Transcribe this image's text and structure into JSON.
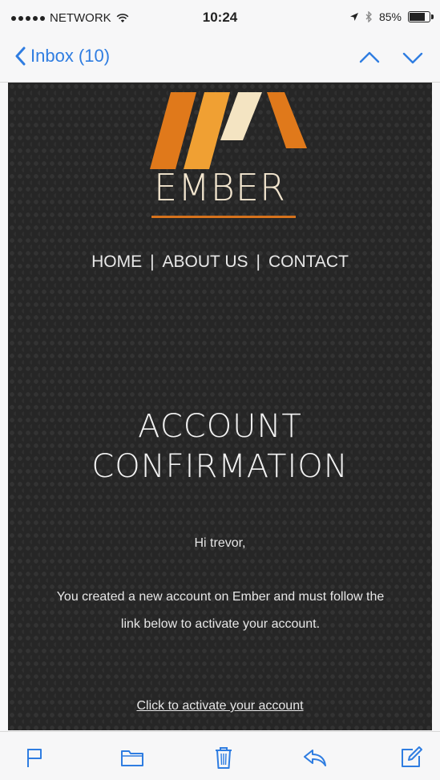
{
  "status_bar": {
    "carrier": "NETWORK",
    "time": "10:24",
    "battery": "85%",
    "battery_level": 0.85
  },
  "nav": {
    "back_label": "Inbox (10)",
    "accent": "#2f7de1"
  },
  "email": {
    "brand": "EMBER",
    "brand_color": "#f3e6cf",
    "accent": "#d6721c",
    "menu": [
      "HOME",
      "ABOUT US",
      "CONTACT"
    ],
    "menu_separator": "|",
    "title_line1": "ACCOUNT",
    "title_line2": "CONFIRMATION",
    "greeting": "Hi trevor,",
    "paragraph": "You created a new account on Ember and must follow the link below to activate your account.",
    "cta": "Click to activate your account"
  },
  "toolbar": {
    "icons": [
      "flag-icon",
      "folder-icon",
      "trash-icon",
      "reply-icon",
      "compose-icon"
    ]
  }
}
